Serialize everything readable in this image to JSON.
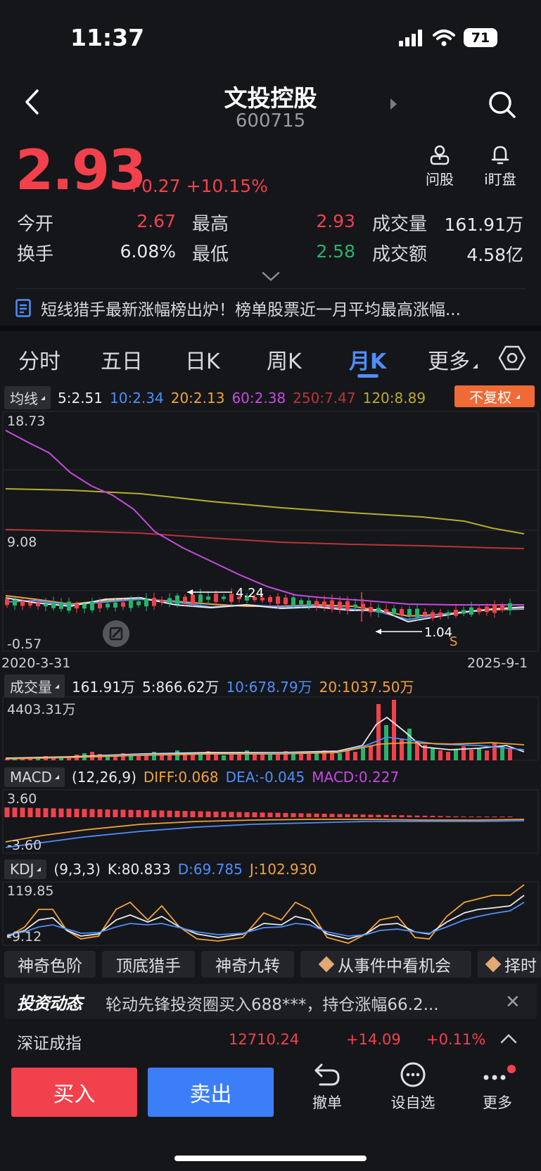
{
  "status_bar": {
    "time": "11:37",
    "battery": "71"
  },
  "header": {
    "title": "文投控股",
    "code": "600715"
  },
  "quote": {
    "price": "2.93",
    "change": "+0.27",
    "change_pct": "+10.15%",
    "ask_label": "问股",
    "watch_label": "i盯盘",
    "open_label": "今开",
    "open": "2.67",
    "high_label": "最高",
    "high": "2.93",
    "volume_label": "成交量",
    "volume": "161.91万",
    "turnover_label": "换手",
    "turnover": "6.08%",
    "low_label": "最低",
    "low": "2.58",
    "amount_label": "成交额",
    "amount": "4.58亿"
  },
  "news": {
    "text": "短线猎手最新涨幅榜出炉！榜单股票近一月平均最高涨幅..."
  },
  "tabs": [
    {
      "label": "分时"
    },
    {
      "label": "五日"
    },
    {
      "label": "日K"
    },
    {
      "label": "周K"
    },
    {
      "label": "月K",
      "active": true
    },
    {
      "label": "更多"
    }
  ],
  "ma": {
    "chip": "均线",
    "ma5": "5:2.51",
    "ma10": "10:2.34",
    "ma20": "20:2.13",
    "ma60": "60:2.38",
    "ma250": "250:7.47",
    "ma120": "120:8.89",
    "fq_label": "不复权"
  },
  "kline": {
    "y_top": "18.73",
    "y_mid": "9.08",
    "y_bottom": "-0.57",
    "date_start": "2020-3-31",
    "date_end": "2025-9-1",
    "high_mark": "4.24",
    "low_mark": "1.04",
    "sell_mark": "S"
  },
  "volume": {
    "chip": "成交量",
    "current": "161.91万",
    "ma5": "5:866.62万",
    "ma10": "10:678.79万",
    "ma20": "20:1037.50万",
    "y_top": "4403.31万"
  },
  "macd": {
    "chip": "MACD",
    "params": "(12,26,9)",
    "diff": "DIFF:0.068",
    "dea": "DEA:-0.045",
    "macd": "MACD:0.227",
    "y_top": "3.60",
    "y_bottom": "-3.60"
  },
  "kdj": {
    "chip": "KDJ",
    "params": "(9,3,3)",
    "k": "K:80.833",
    "d": "D:69.785",
    "j": "J:102.930",
    "y_top": "119.85",
    "y_bottom": "-9.12"
  },
  "tools": [
    "神奇色阶",
    "顶底猎手",
    "神奇九转",
    "从事件中看机会",
    "择时"
  ],
  "dynamics": {
    "logo": "投资动态",
    "text": "轮动先锋投资圈买入688***，持仓涨幅66.2..."
  },
  "index": {
    "name": "深证成指",
    "value": "12710.24",
    "change": "+14.09",
    "change_pct": "+0.11%"
  },
  "actions": {
    "buy": "买入",
    "sell": "卖出",
    "cancel": "撤单",
    "watchlist": "设自选",
    "more": "更多"
  },
  "colors": {
    "up": "#f2414c",
    "down": "#26b46c",
    "ma5": "#e9e9ea",
    "ma10": "#4d8ffa",
    "ma20": "#f0a23b",
    "ma60": "#c64be0",
    "ma250": "#b8343a",
    "ma120": "#b5ad2c"
  }
}
